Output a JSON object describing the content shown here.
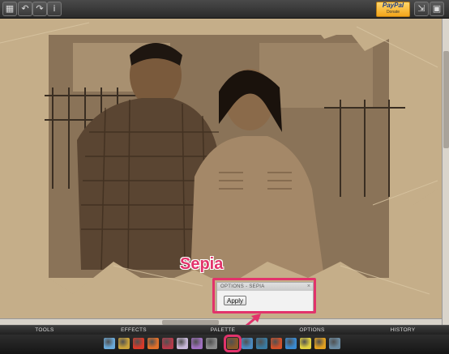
{
  "toolbar": {
    "icons": [
      "undo-icon",
      "redo-icon",
      "info-icon"
    ],
    "paypal_label": "PayPal",
    "paypal_sub": "Donate",
    "right_icons": [
      "export-icon",
      "save-icon"
    ]
  },
  "annotation": {
    "label": "Sepia",
    "color": "#e2336b"
  },
  "options_panel": {
    "title": "OPTIONS - SEPIA",
    "apply_label": "Apply"
  },
  "tabs": [
    {
      "label": "TOOLS"
    },
    {
      "label": "EFFECTS"
    },
    {
      "label": "PALETTE"
    },
    {
      "label": "OPTIONS"
    },
    {
      "label": "HISTORY"
    }
  ],
  "effect_icons": [
    {
      "name": "water-drop-icon",
      "color": "#6aa9d8"
    },
    {
      "name": "pencil-icon",
      "color": "#c9a23a"
    },
    {
      "name": "red-circle-icon",
      "color": "#d83a2a"
    },
    {
      "name": "colorful-blocks-icon",
      "color": "#e0702a"
    },
    {
      "name": "film-icon",
      "color": "#b43a4a"
    },
    {
      "name": "heart-icon",
      "color": "#c8b8d8"
    },
    {
      "name": "puzzle-icon",
      "color": "#a070c0"
    },
    {
      "name": "wand-icon",
      "color": "#8a8a8a"
    },
    {
      "name": "sepia-effect-icon",
      "color": "#8a5a2a"
    },
    {
      "name": "photo-icon",
      "color": "#4a8ac0"
    },
    {
      "name": "landscape-icon",
      "color": "#3a7aa0"
    },
    {
      "name": "color-cube-icon",
      "color": "#d0502a"
    },
    {
      "name": "globe-icon",
      "color": "#3a8ad0"
    },
    {
      "name": "lightbulb-icon",
      "color": "#e0d040"
    },
    {
      "name": "bar-chart-icon",
      "color": "#e0a020"
    },
    {
      "name": "city-icon",
      "color": "#6a8aa0"
    }
  ]
}
